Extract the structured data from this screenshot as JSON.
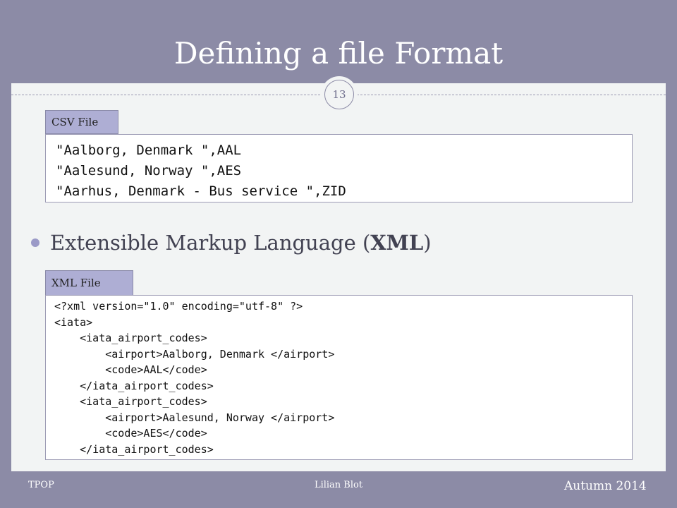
{
  "slide": {
    "title": "Defining a file Format",
    "page_number": "13"
  },
  "csv": {
    "label": "CSV File",
    "lines": [
      "\"Aalborg, Denmark \",AAL",
      "\"Aalesund, Norway \",AES",
      "\"Aarhus, Denmark - Bus service \",ZID"
    ]
  },
  "bullet": {
    "text_before": "Extensible Markup Language (",
    "text_bold": "XML",
    "text_after": ")"
  },
  "xml": {
    "label": "XML File",
    "lines": [
      "<?xml version=\"1.0\" encoding=\"utf-8\" ?>",
      "<iata>",
      "    <iata_airport_codes>",
      "        <airport>Aalborg, Denmark </airport>",
      "        <code>AAL</code>",
      "    </iata_airport_codes>",
      "    <iata_airport_codes>",
      "        <airport>Aalesund, Norway </airport>",
      "        <code>AES</code>",
      "    </iata_airport_codes>"
    ]
  },
  "footer": {
    "left": "TPOP",
    "center": "Lilian Blot",
    "right": "Autumn 2014"
  }
}
